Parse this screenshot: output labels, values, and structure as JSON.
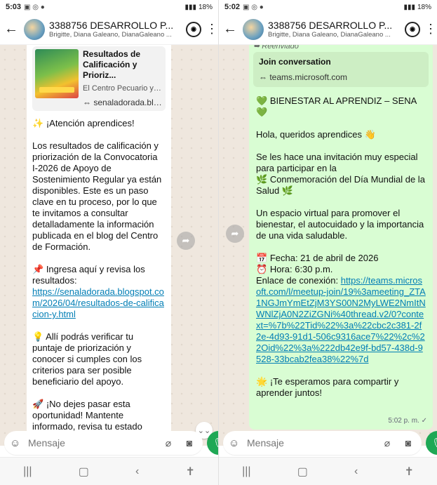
{
  "left": {
    "status": {
      "time": "5:03",
      "battery": "18%"
    },
    "header": {
      "title": "3388756 DESARROLLO P...",
      "members": "Brigitte, Diana Galeano, DianaGaleano ..."
    },
    "preview": {
      "title": "Resultados de Calificación y Prioriz...",
      "desc": "El Centro Pecuario y Agr...",
      "url": "senaladorada.blo..."
    },
    "message": {
      "attention": "¡Atención aprendices!",
      "p1": "Los resultados de calificación y priorización de la Convocatoria I-2026 de Apoyo de Sostenimiento Regular ya están disponibles. Este es un paso clave en tu proceso, por lo que te invitamos a consultar detalladamente la información publicada en el blog del Centro de Formación.",
      "ingresa": "Ingresa aquí y revisa los resultados:",
      "link": "https://senaladorada.blogspot.com/2026/04/resultados-de-calificacion-y.html",
      "p3": "Allí podrás verificar tu puntaje de priorización y conocer si cumples con los criterios para ser posible beneficiario del apoyo.",
      "p4": "¡No dejes pasar esta oportunidad! Mantente informado, revisa tu estado"
    },
    "composer": {
      "placeholder": "Mensaje"
    }
  },
  "right": {
    "status": {
      "time": "5:02",
      "battery": "18%"
    },
    "header": {
      "title": "3388756 DESARROLLO P...",
      "members": "Brigitte, Diana Galeano, DianaGaleano ..."
    },
    "forwarded": "Reenviado",
    "join": {
      "title": "Join conversation",
      "url": "teams.microsoft.com"
    },
    "message": {
      "heading": "BIENESTAR AL APRENDIZ – SENA",
      "greeting": "Hola, queridos aprendices",
      "invite": "Se les hace una invitación muy especial para participar en la",
      "event": "Conmemoración del Día Mundial de la Salud",
      "desc": "Un espacio virtual para promover el bienestar, el autocuidado y la importancia de una vida saludable.",
      "date": "Fecha: 21 de abril de 2026",
      "hour": "Hora: 6:30 p.m.",
      "link_label": "Enlace de conexión:",
      "link": "https://teams.microsoft.com/l/meetup-join/19%3ameeting_ZTA1NGJmYmEtZjM3YS00N2MyLWE2NmItNWNlZjA0N2ZiZGNi%40thread.v2/0?context=%7b%22Tid%22%3a%22cbc2c381-2f2e-4d93-91d1-506c9316ace7%22%2c%22Oid%22%3a%222db42e9f-bd57-438d-9528-33bcab2fea38%22%7d",
      "closing": "¡Te esperamos para compartir y aprender juntos!",
      "time": "5:02 p. m."
    },
    "composer": {
      "placeholder": "Mensaje"
    }
  },
  "icons": {
    "sparkle": "✨",
    "pin": "📌",
    "bulb": "💡",
    "rocket": "🚀",
    "heart": "💚",
    "wave": "👋",
    "herb": "🌿",
    "calendar": "📅",
    "clock": "⏰",
    "star": "🌟"
  },
  "colors": {
    "accent": "#1fa855",
    "bubble_out": "#d9fdd3",
    "link": "#027eb5",
    "chat_bg": "#efe7de"
  }
}
